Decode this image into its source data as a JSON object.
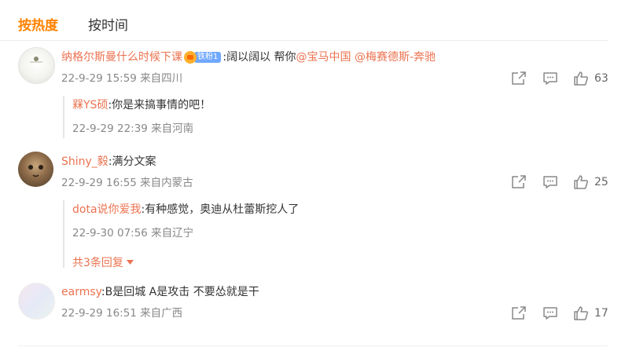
{
  "tabs": [
    {
      "label": "按热度",
      "active": true
    },
    {
      "label": "按时间",
      "active": false
    }
  ],
  "comments": [
    {
      "user": "纳格尔斯曼什么时候下课",
      "badge": "铁粉1",
      "text": ":阔以阔以 帮你",
      "mentions": [
        "@宝马中国",
        "@梅赛德斯-奔驰"
      ],
      "meta": "22-9-29 15:59 来自四川",
      "likes": "63",
      "reply": {
        "user": "槑YS硕",
        "text": ":你是来搞事情的吧！",
        "meta": "22-9-29 22:39 来自河南"
      }
    },
    {
      "user": "Shiny_毅",
      "text": ":满分文案",
      "meta": "22-9-29 16:55 来自内蒙古",
      "likes": "25",
      "reply": {
        "user": "dota说你爱我",
        "text": ":有种感觉，奥迪从杜蕾斯挖人了",
        "meta": "22-9-30 07:56 来自辽宁",
        "more": "共3条回复"
      }
    },
    {
      "user": "earmsy",
      "text": ":B是回城 A是攻击 不要怂就是干",
      "meta": "22-9-29 16:51 来自广西",
      "likes": "17"
    }
  ],
  "colors": {
    "accent": "#ff8200",
    "link": "#eb7350",
    "meta": "#888888"
  }
}
